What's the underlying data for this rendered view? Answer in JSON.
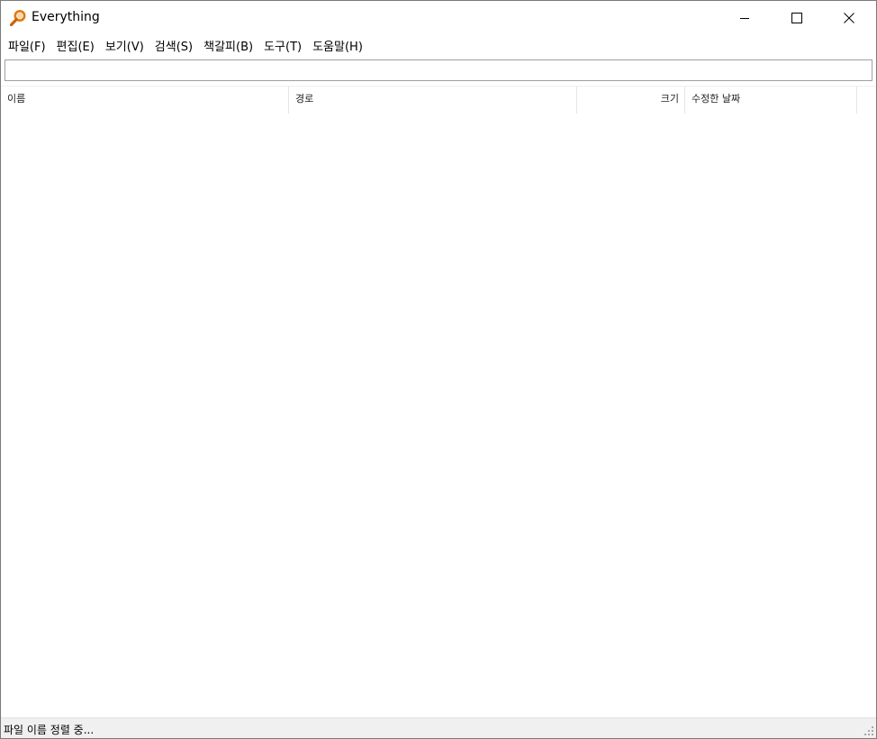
{
  "window": {
    "title": "Everything",
    "icon": "magnifier-icon"
  },
  "caption_buttons": {
    "minimize": "minimize-icon",
    "maximize": "maximize-icon",
    "close": "close-icon"
  },
  "menu": {
    "items": [
      {
        "label": "파일(F)"
      },
      {
        "label": "편집(E)"
      },
      {
        "label": "보기(V)"
      },
      {
        "label": "검색(S)"
      },
      {
        "label": "책갈피(B)"
      },
      {
        "label": "도구(T)"
      },
      {
        "label": "도움말(H)"
      }
    ]
  },
  "search": {
    "value": "",
    "placeholder": ""
  },
  "columns": {
    "name": "이름",
    "path": "경로",
    "size": "크기",
    "modified": "수정한 날짜"
  },
  "results": [],
  "status": {
    "text": "파일 이름 정렬 중..."
  },
  "colors": {
    "icon_orange": "#e07a10",
    "statusbar_bg": "#f0f0f0",
    "border": "#a0a0a0"
  }
}
